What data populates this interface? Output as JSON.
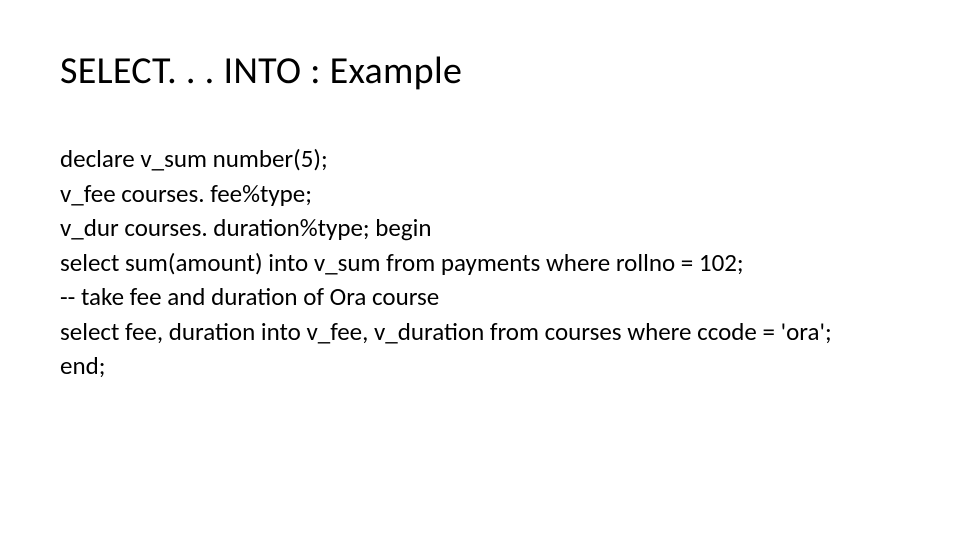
{
  "title": "SELECT. . . INTO  : Example",
  "code": {
    "l1": "declare      v_sum number(5);",
    "l2": "v_fee courses. fee%type;",
    "l3": "v_dur courses. duration%type; begin",
    "l4": "select  sum(amount) into v_sum      from payments      where rollno = 102;",
    "l5": "-- take fee and duration of Ora course",
    "l6": " select fee, duration into v_fee, v_duration       from   courses       where   ccode = 'ora';",
    "l7": "end;"
  }
}
